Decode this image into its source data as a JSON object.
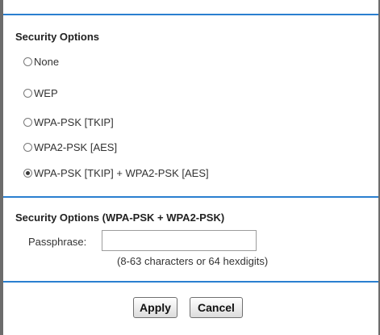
{
  "security_options": {
    "heading": "Security Options",
    "selected": "WPA-PSK [TKIP] + WPA2-PSK [AES]",
    "options": [
      {
        "label": "None",
        "checked": false
      },
      {
        "label": "WEP",
        "checked": false
      },
      {
        "label": "WPA-PSK [TKIP]",
        "checked": false
      },
      {
        "label": "WPA2-PSK [AES]",
        "checked": false
      },
      {
        "label": "WPA-PSK [TKIP] + WPA2-PSK [AES]",
        "checked": true
      }
    ]
  },
  "wpa_section": {
    "heading": "Security Options (WPA-PSK + WPA2-PSK)",
    "passphrase_label": "Passphrase:",
    "passphrase_value": "",
    "passphrase_hint": "(8-63 characters or 64 hexdigits)"
  },
  "actions": {
    "apply_label": "Apply",
    "cancel_label": "Cancel"
  },
  "colors": {
    "accent_rule": "#2a7fd0",
    "frame_edge": "#6c6c6c"
  }
}
